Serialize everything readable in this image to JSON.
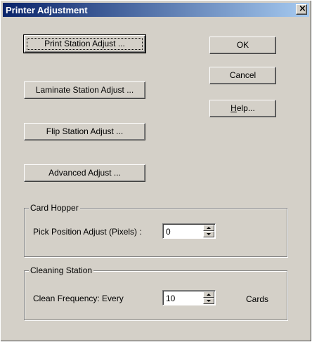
{
  "window": {
    "title": "Printer Adjustment",
    "close_glyph": "×",
    "close_icon": "close-icon"
  },
  "buttons": {
    "print_station": "Print Station Adjust ...",
    "laminate_station": "Laminate Station Adjust ...",
    "flip_station": "Flip Station Adjust ...",
    "advanced": "Advanced Adjust ...",
    "ok": "OK",
    "cancel": "Cancel",
    "help_mnemonic": "H",
    "help_rest": "elp..."
  },
  "card_hopper": {
    "legend": "Card Hopper",
    "label": "Pick Position Adjust (Pixels) :",
    "value": "0"
  },
  "cleaning_station": {
    "legend": "Cleaning Station",
    "label": "Clean Frequency: Every",
    "value": "10",
    "unit": "Cards"
  },
  "colors": {
    "dialog_face": "#d4d0c8",
    "titlebar_start": "#0a246a",
    "titlebar_end": "#a6caf0"
  }
}
